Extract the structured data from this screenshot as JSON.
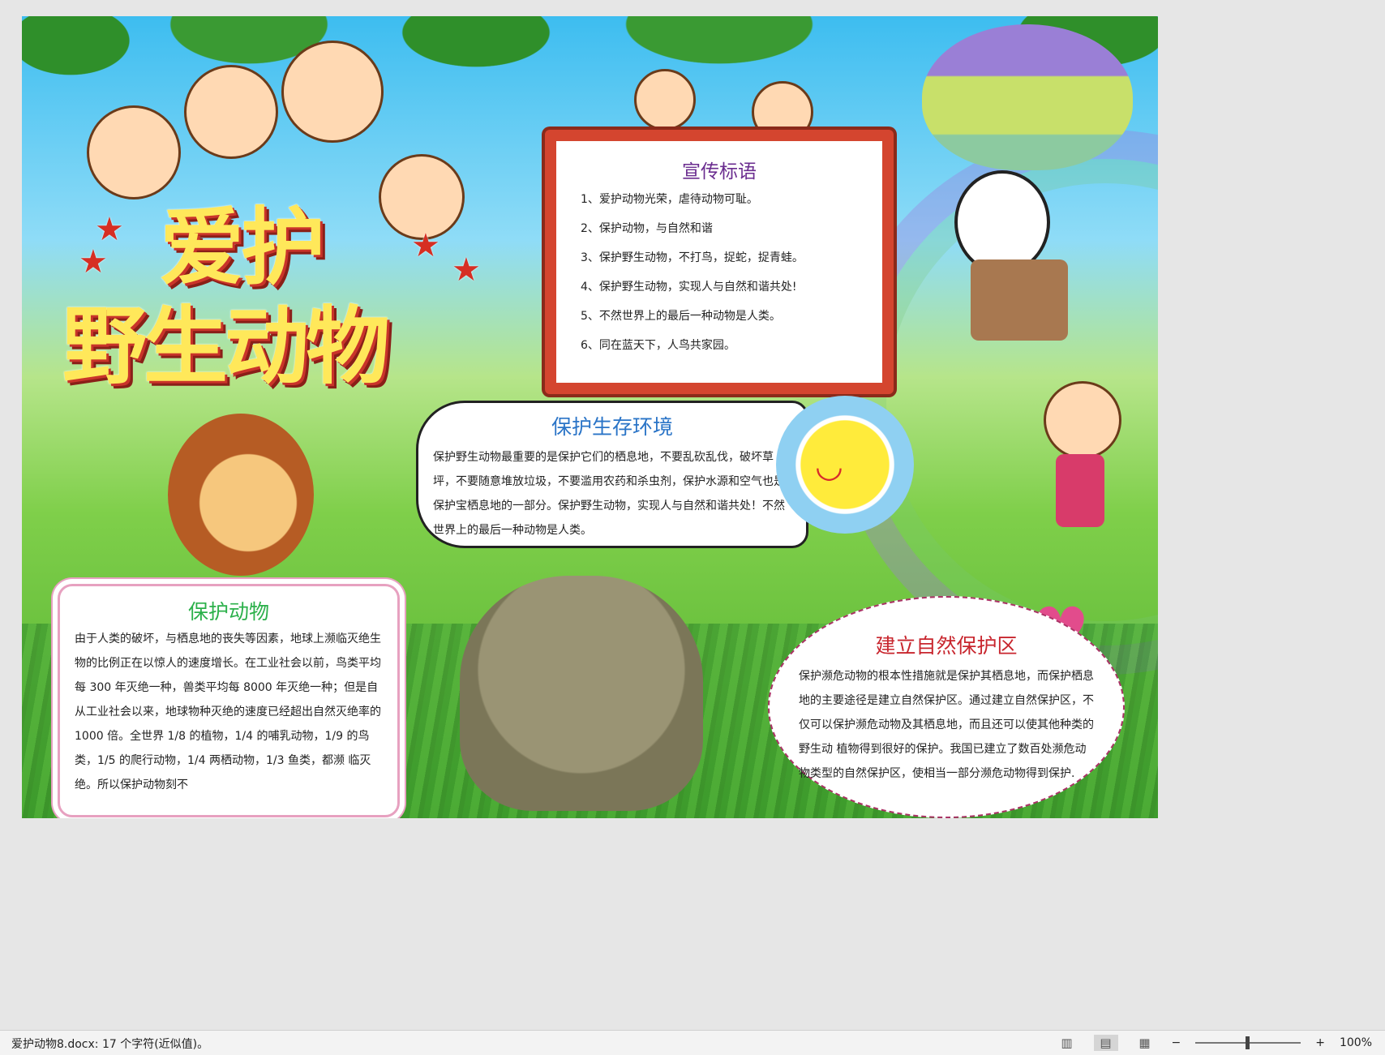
{
  "poster": {
    "title_line1": "爱护",
    "title_line2": "野生动物",
    "slogans": {
      "heading": "宣传标语",
      "items": [
        "1、爱护动物光荣，虐待动物可耻。",
        "2、保护动物，与自然和谐",
        "3、保护野生动物，不打鸟，捉蛇，捉青蛙。",
        "4、保护野生动物，实现人与自然和谐共处!",
        "5、不然世界上的最后一种动物是人类。",
        "6、同在蓝天下，人鸟共家园。"
      ]
    },
    "habitat": {
      "heading": "保护生存环境",
      "body": "保护野生动物最重要的是保护它们的栖息地，不要乱砍乱伐，破坏草坪，不要随意堆放垃圾，不要滥用农药和杀虫剂，保护水源和空气也是保护宝栖息地的一部分。保护野生动物，实现人与自然和谐共处！不然世界上的最后一种动物是人类。"
    },
    "protect_animals": {
      "heading": "保护动物",
      "body": "由于人类的破坏，与栖息地的丧失等因素，地球上濒临灭绝生物的比例正在以惊人的速度增长。在工业社会以前，鸟类平均每 300 年灭绝一种，兽类平均每 8000 年灭绝一种；但是自从工业社会以来，地球物种灭绝的速度已经超出自然灭绝率的 1000 倍。全世界 1/8 的植物，1/4 的哺乳动物，1/9 的鸟类，1/5 的爬行动物，1/4 两栖动物，1/3 鱼类，都濒 临灭绝。所以保护动物刻不"
    },
    "reserve": {
      "heading": "建立自然保护区",
      "body": "保护濒危动物的根本性措施就是保护其栖息地，而保护栖息地的主要途径是建立自然保护区。通过建立自然保护区，不仅可以保护濒危动物及其栖息地，而且还可以使其他种类的野生动 植物得到很好的保护。我国已建立了数百处濒危动物类型的自然保护区，使相当一部分濒危动物得到保护."
    }
  },
  "statusbar": {
    "doc_info": "爱护动物8.docx: 17 个字符(近似值)。",
    "zoom": "100%",
    "zoom_minus": "−",
    "zoom_plus": "+"
  }
}
